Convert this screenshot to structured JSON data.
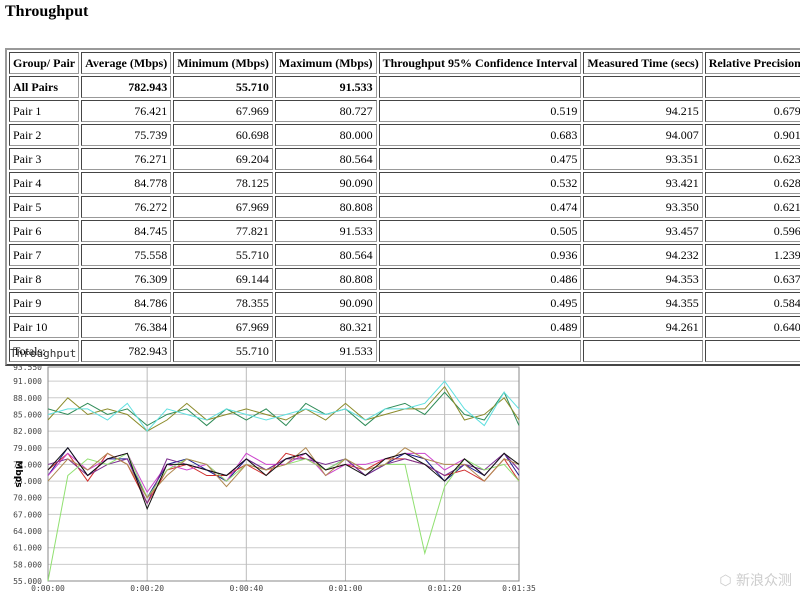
{
  "title": "Throughput",
  "table": {
    "headers": [
      "Group/ Pair",
      "Average (Mbps)",
      "Minimum (Mbps)",
      "Maximum (Mbps)",
      "Throughput 95% Confidence Interval",
      "Measured Time (secs)",
      "Relative Precision"
    ],
    "rows": [
      [
        "All Pairs",
        "782.943",
        "55.710",
        "91.533",
        "",
        "",
        ""
      ],
      [
        "Pair 1",
        "76.421",
        "67.969",
        "80.727",
        "0.519",
        "94.215",
        "0.679"
      ],
      [
        "Pair 2",
        "75.739",
        "60.698",
        "80.000",
        "0.683",
        "94.007",
        "0.901"
      ],
      [
        "Pair 3",
        "76.271",
        "69.204",
        "80.564",
        "0.475",
        "93.351",
        "0.623"
      ],
      [
        "Pair 4",
        "84.778",
        "78.125",
        "90.090",
        "0.532",
        "93.421",
        "0.628"
      ],
      [
        "Pair 5",
        "76.272",
        "67.969",
        "80.808",
        "0.474",
        "93.350",
        "0.621"
      ],
      [
        "Pair 6",
        "84.745",
        "77.821",
        "91.533",
        "0.505",
        "93.457",
        "0.596"
      ],
      [
        "Pair 7",
        "75.558",
        "55.710",
        "80.564",
        "0.936",
        "94.232",
        "1.239"
      ],
      [
        "Pair 8",
        "76.309",
        "69.144",
        "80.808",
        "0.486",
        "94.353",
        "0.637"
      ],
      [
        "Pair 9",
        "84.786",
        "78.355",
        "90.090",
        "0.495",
        "94.355",
        "0.584"
      ],
      [
        "Pair 10",
        "76.384",
        "67.969",
        "80.321",
        "0.489",
        "94.261",
        "0.640"
      ],
      [
        "Totals:",
        "782.943",
        "55.710",
        "91.533",
        "",
        "",
        ""
      ]
    ]
  },
  "chart_data": {
    "type": "line",
    "title": "Throughput",
    "ylabel": "Mbps",
    "ylim": [
      55,
      93.55
    ],
    "yticks": [
      "55.000",
      "58.000",
      "61.000",
      "64.000",
      "67.000",
      "70.000",
      "73.000",
      "76.000",
      "79.000",
      "82.000",
      "85.000",
      "88.000",
      "91.000",
      "93.550"
    ],
    "xlim": [
      0,
      95
    ],
    "xticks": [
      {
        "v": 0,
        "label": "0:00:00"
      },
      {
        "v": 20,
        "label": "0:00:20"
      },
      {
        "v": 40,
        "label": "0:00:40"
      },
      {
        "v": 60,
        "label": "0:01:00"
      },
      {
        "v": 80,
        "label": "0:01:20"
      },
      {
        "v": 95,
        "label": "0:01:35"
      }
    ],
    "grid": true,
    "x": [
      0,
      4,
      8,
      12,
      16,
      20,
      24,
      28,
      32,
      36,
      40,
      44,
      48,
      52,
      56,
      60,
      64,
      68,
      72,
      76,
      80,
      84,
      88,
      92,
      95
    ],
    "series": [
      {
        "color": "#1a1a8c",
        "values": [
          74,
          79,
          74,
          77,
          77,
          70,
          76,
          77,
          75,
          73,
          77,
          75,
          77,
          78,
          75,
          77,
          74,
          76,
          78,
          77,
          73,
          76,
          74,
          78,
          74
        ]
      },
      {
        "color": "#d03030",
        "values": [
          75,
          78,
          73,
          78,
          76,
          69,
          75,
          76,
          74,
          74,
          76,
          74,
          78,
          77,
          75,
          76,
          75,
          77,
          77,
          76,
          74,
          75,
          73,
          77,
          73
        ]
      },
      {
        "color": "#cc44cc",
        "values": [
          74,
          78,
          75,
          77,
          78,
          71,
          76,
          75,
          76,
          73,
          78,
          76,
          76,
          78,
          74,
          76,
          76,
          77,
          78,
          78,
          75,
          77,
          74,
          78,
          75
        ]
      },
      {
        "color": "#2e8b57",
        "values": [
          86,
          85,
          87,
          85,
          86,
          83,
          85,
          86,
          83,
          86,
          84,
          86,
          83,
          87,
          85,
          86,
          83,
          86,
          87,
          85,
          89,
          85,
          84,
          89,
          83
        ]
      },
      {
        "color": "#7b2d8e",
        "values": [
          76,
          77,
          74,
          76,
          77,
          69,
          77,
          76,
          75,
          74,
          77,
          75,
          77,
          77,
          76,
          77,
          74,
          76,
          77,
          76,
          74,
          76,
          75,
          78,
          75
        ]
      },
      {
        "color": "#8b8b2a",
        "values": [
          84,
          88,
          85,
          86,
          85,
          82,
          84,
          87,
          84,
          85,
          86,
          85,
          84,
          86,
          84,
          87,
          84,
          85,
          86,
          86,
          90,
          84,
          85,
          88,
          84
        ]
      },
      {
        "color": "#90e070",
        "values": [
          55,
          74,
          77,
          76,
          78,
          70,
          75,
          77,
          76,
          73,
          76,
          75,
          76,
          77,
          75,
          77,
          75,
          76,
          76,
          60,
          72,
          77,
          75,
          76,
          73
        ]
      },
      {
        "color": "#b08850",
        "values": [
          73,
          77,
          75,
          78,
          76,
          70,
          74,
          77,
          76,
          72,
          76,
          75,
          76,
          79,
          74,
          77,
          75,
          76,
          79,
          77,
          76,
          76,
          73,
          77,
          76
        ]
      },
      {
        "color": "#60e0e0",
        "values": [
          85,
          86,
          86,
          84,
          87,
          82,
          86,
          85,
          84,
          86,
          85,
          84,
          85,
          86,
          85,
          86,
          84,
          86,
          86,
          87,
          91,
          86,
          83,
          89,
          86
        ]
      },
      {
        "color": "#111111",
        "values": [
          75,
          79,
          74,
          77,
          78,
          68,
          76,
          76,
          75,
          74,
          77,
          74,
          77,
          78,
          75,
          76,
          74,
          77,
          78,
          76,
          73,
          77,
          74,
          78,
          76
        ]
      }
    ]
  },
  "watermark": "新浪众测"
}
